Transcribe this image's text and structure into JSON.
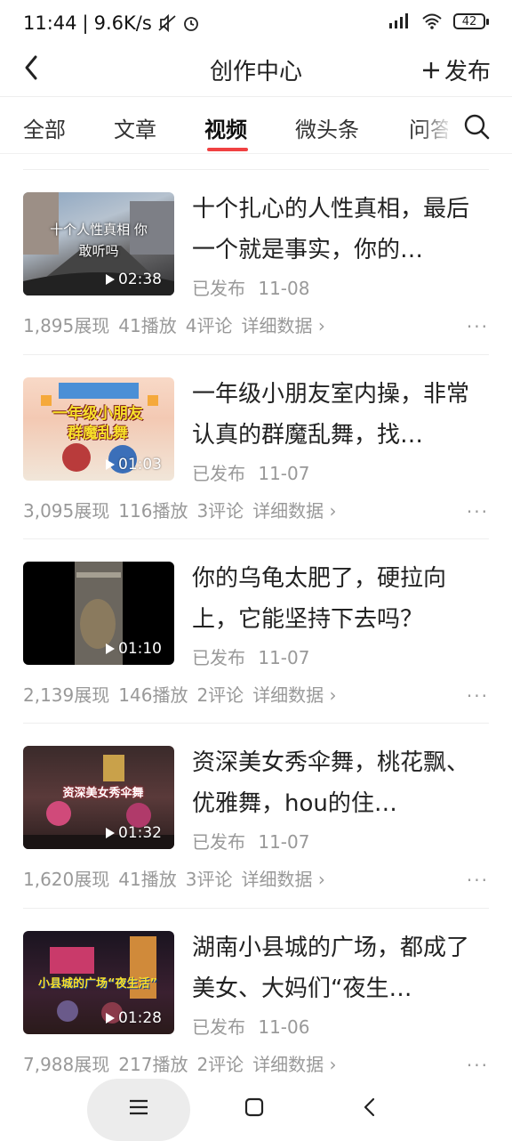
{
  "status_bar": {
    "time": "11:44",
    "net_speed": "9.6K/s",
    "battery": "42",
    "icons": [
      "mute-icon",
      "alarm-icon",
      "signal-icon",
      "wifi-icon",
      "battery-icon"
    ]
  },
  "header": {
    "title": "创作中心",
    "publish_label": "发布"
  },
  "tabs": [
    {
      "label": "全部"
    },
    {
      "label": "文章"
    },
    {
      "label": "视频"
    },
    {
      "label": "微头条"
    },
    {
      "label": "问答"
    }
  ],
  "active_tab": "视频",
  "colors": {
    "accent": "#f04142",
    "text": "#222222",
    "muted": "#999999"
  },
  "items": [
    {
      "title": "十个扎心的人性真相，最后一个就是事实，你的…",
      "status": "已发布",
      "date": "11-08",
      "duration": "02:38",
      "views": "1,895展现",
      "plays": "41播放",
      "comments": "4评论",
      "detail": "详细数据",
      "thumb_text": "十个人性真相 你敢听吗"
    },
    {
      "title": "一年级小朋友室内操，非常认真的群魔乱舞，找…",
      "status": "已发布",
      "date": "11-07",
      "duration": "01:03",
      "views": "3,095展现",
      "plays": "116播放",
      "comments": "3评论",
      "detail": "详细数据",
      "thumb_text": "一年级小朋友 群魔乱舞"
    },
    {
      "title": "你的乌龟太肥了，硬拉向上，它能坚持下去吗？",
      "status": "已发布",
      "date": "11-07",
      "duration": "01:10",
      "views": "2,139展现",
      "plays": "146播放",
      "comments": "2评论",
      "detail": "详细数据",
      "thumb_text": ""
    },
    {
      "title": "资深美女秀伞舞，桃花飘、优雅舞，hou的住…",
      "status": "已发布",
      "date": "11-07",
      "duration": "01:32",
      "views": "1,620展现",
      "plays": "41播放",
      "comments": "3评论",
      "detail": "详细数据",
      "thumb_text": "资深美女秀伞舞"
    },
    {
      "title": "湖南小县城的广场，都成了美女、大妈们“夜生…",
      "status": "已发布",
      "date": "11-06",
      "duration": "01:28",
      "views": "7,988展现",
      "plays": "217播放",
      "comments": "2评论",
      "detail": "详细数据",
      "thumb_text": "小县城的广场“夜生活”"
    }
  ]
}
